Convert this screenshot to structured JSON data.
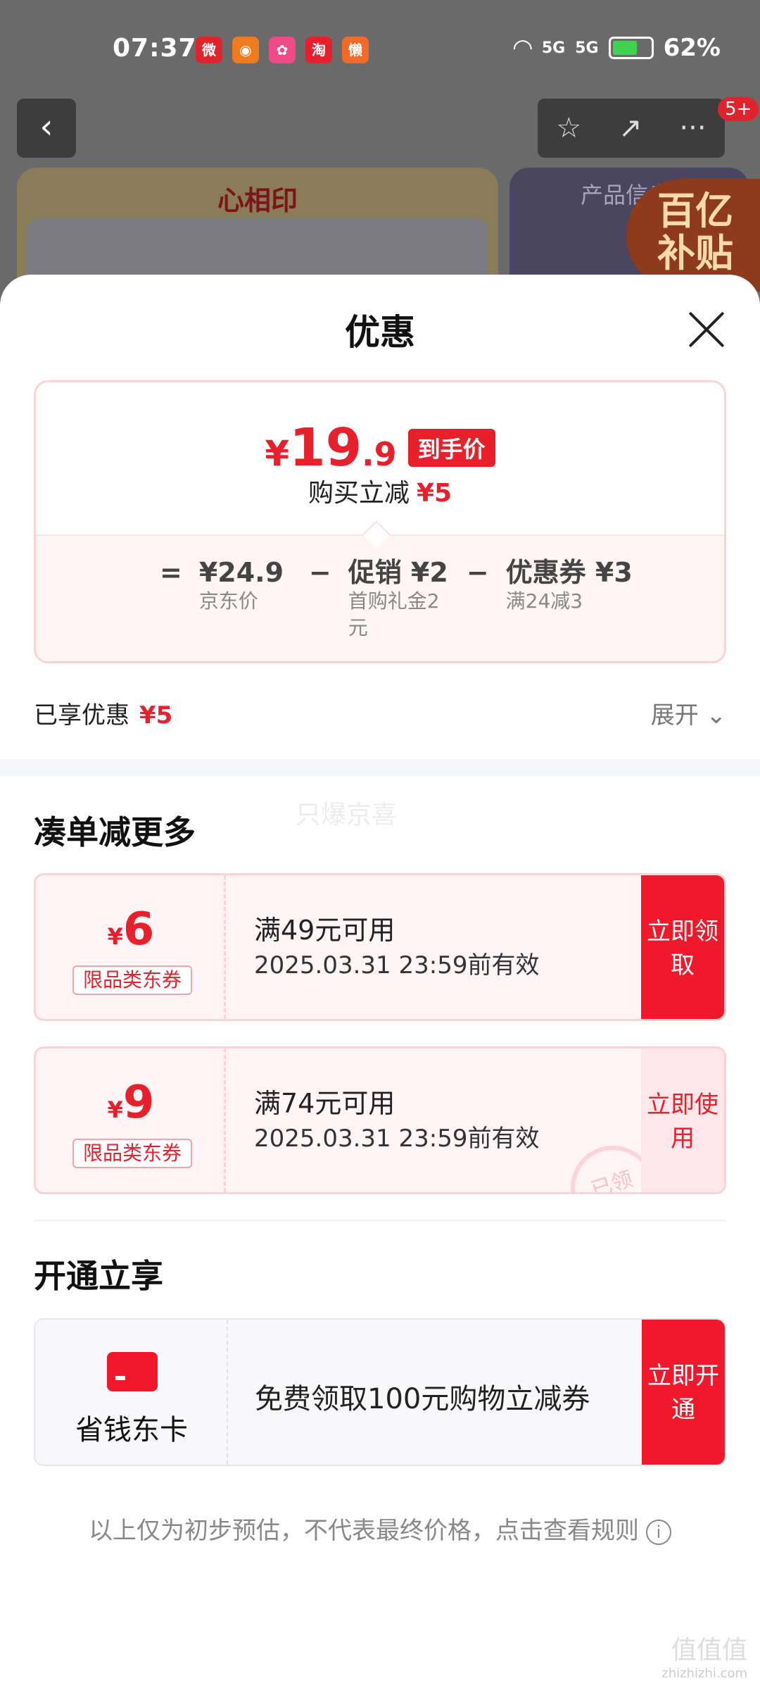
{
  "status_bar": {
    "time": "07:37",
    "signal1": "5G",
    "signal2": "5G",
    "battery": "62%"
  },
  "status_apps": [
    {
      "icon": "weibo-icon",
      "label": "微",
      "color": "#e0242c"
    },
    {
      "icon": "app-orange-icon",
      "label": "◉",
      "color": "#f07a1e"
    },
    {
      "icon": "app-pink-icon",
      "label": "✿",
      "color": "#ef4b86"
    },
    {
      "icon": "taobao-icon",
      "label": "淘",
      "color": "#e8202c"
    },
    {
      "icon": "app-lazy-icon",
      "label": "懒",
      "color": "#f06a2a"
    }
  ],
  "nav": {
    "badge": "5+",
    "back": "‹",
    "star": "☆",
    "share": "↗",
    "more": "···"
  },
  "product": {
    "brand_logo": "心相印",
    "info_title": "产品信息",
    "promo_badge_line1": "百亿",
    "promo_badge_line2": "补贴"
  },
  "sheet": {
    "title": "优惠"
  },
  "price": {
    "yen": "¥",
    "integer": "19",
    "decimal": ".9",
    "tag": "到手价",
    "cut_label": "购买立减",
    "cut_value": "¥5"
  },
  "formula": {
    "eq": "=",
    "minus1": "−",
    "minus2": "−",
    "items": [
      {
        "main": "¥24.9",
        "sub": "京东价"
      },
      {
        "main": "促销 ¥2",
        "sub": "首购礼金2元"
      },
      {
        "main": "优惠券 ¥3",
        "sub": "满24减3"
      }
    ]
  },
  "enjoyed": {
    "label": "已享优惠",
    "value": "¥5",
    "expand": "展开 ⌄"
  },
  "more_section": {
    "title": "凑单减更多",
    "watermark": "只爆京喜"
  },
  "coupons": [
    {
      "yen": "¥",
      "amount": "6",
      "tag": "限品类东券",
      "condition": "满49元可用",
      "validity": "2025.03.31 23:59前有效",
      "button": "立即领取"
    },
    {
      "yen": "¥",
      "amount": "9",
      "tag": "限品类东券",
      "condition": "满74元可用",
      "validity": "2025.03.31 23:59前有效",
      "button": "立即使用",
      "stamp": "已领"
    }
  ],
  "member_section": {
    "title": "开通立享"
  },
  "member_card": {
    "name": "省钱东卡",
    "text": "免费领取100元购物立减券",
    "button": "立即开通"
  },
  "footnote": {
    "text": "以上仅为初步预估，不代表最终价格，点击查看规则",
    "icon": "i"
  },
  "site": {
    "name": "值值值",
    "url": "zhizhizhi.com"
  }
}
